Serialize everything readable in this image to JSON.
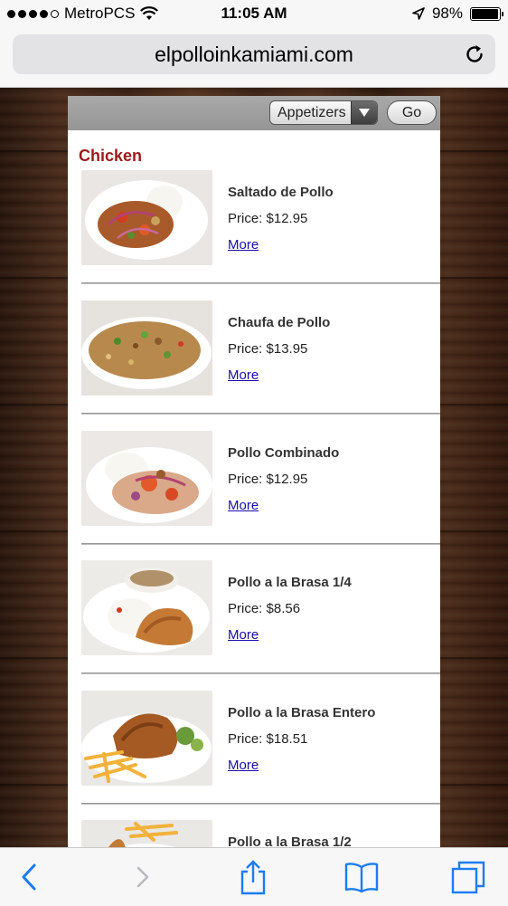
{
  "status_bar": {
    "carrier": "MetroPCS",
    "time": "11:05 AM",
    "battery": "98%",
    "battery_level": 0.98,
    "signal_bars": 4
  },
  "browser": {
    "url": "elpolloinkamiami.com",
    "icons": [
      "reload-icon",
      "back-icon",
      "forward-icon",
      "share-icon",
      "bookmarks-icon",
      "tabs-icon"
    ]
  },
  "toolbar": {
    "category_select": "Appetizers",
    "go_label": "Go"
  },
  "section": {
    "title": "Chicken"
  },
  "items": [
    {
      "name": "Saltado de Pollo",
      "price": "Price: $12.95",
      "more": "More"
    },
    {
      "name": "Chaufa de Pollo",
      "price": "Price: $13.95",
      "more": "More"
    },
    {
      "name": "Pollo Combinado",
      "price": "Price: $12.95",
      "more": "More"
    },
    {
      "name": "Pollo a la Brasa 1/4",
      "price": "Price: $8.56",
      "more": "More"
    },
    {
      "name": "Pollo a la Brasa Entero",
      "price": "Price: $18.51",
      "more": "More"
    },
    {
      "name": "Pollo a la Brasa 1/2",
      "price": "",
      "more": ""
    }
  ],
  "colors": {
    "section_title": "#9b1b1b",
    "link": "#1a0dab",
    "ios_blue": "#1a7cf4"
  }
}
